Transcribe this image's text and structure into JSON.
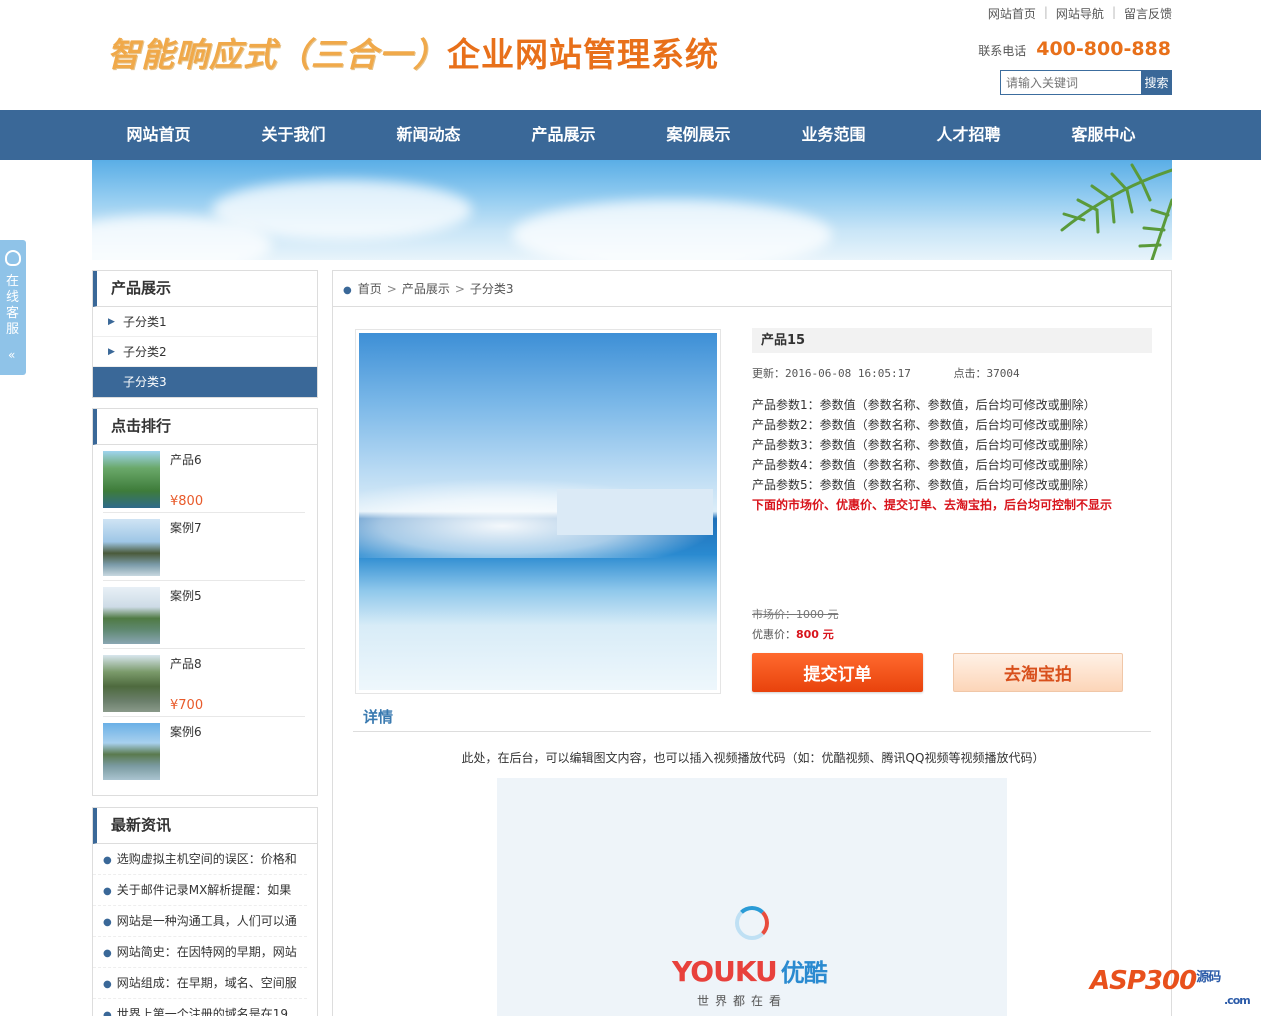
{
  "header": {
    "top_links": [
      "网站首页",
      "网站导航",
      "留言反馈"
    ],
    "title_part1": "智能响应式（三合一）",
    "title_part2": "企业网站管理系统",
    "phone_label": "联系电话",
    "phone_number": "400-800-888",
    "search_placeholder": "请输入关键词",
    "search_button": "搜索"
  },
  "nav": [
    "网站首页",
    "关于我们",
    "新闻动态",
    "产品展示",
    "案例展示",
    "业务范围",
    "人才招聘",
    "客服中心"
  ],
  "service_tab": {
    "label": "在线客服",
    "arrow": "«"
  },
  "sidebar": {
    "categories": {
      "title": "产品展示",
      "items": [
        {
          "label": "子分类1",
          "active": false
        },
        {
          "label": "子分类2",
          "active": false
        },
        {
          "label": "子分类3",
          "active": true
        }
      ]
    },
    "ranking": {
      "title": "点击排行",
      "items": [
        {
          "name": "产品6",
          "price": "¥800"
        },
        {
          "name": "案例7",
          "price": ""
        },
        {
          "name": "案例5",
          "price": ""
        },
        {
          "name": "产品8",
          "price": "¥700"
        },
        {
          "name": "案例6",
          "price": ""
        }
      ]
    },
    "news": {
      "title": "最新资讯",
      "items": [
        "选购虚拟主机空间的误区：价格和",
        "关于邮件记录MX解析提醒：如果",
        "网站是一种沟通工具，人们可以通",
        "网站简史：在因特网的早期，网站",
        "网站组成：在早期，域名、空间服",
        "世界上第一个注册的域名是在19"
      ]
    }
  },
  "breadcrumb": [
    "首页",
    "产品展示",
    "子分类3"
  ],
  "product": {
    "title": "产品15",
    "updated_label": "更新：",
    "updated": "2016-06-08 16:05:17",
    "hits_label": "点击：",
    "hits": "37004",
    "params": [
      "产品参数1：参数值（参数名称、参数值，后台均可修改或删除）",
      "产品参数2：参数值（参数名称、参数值，后台均可修改或删除）",
      "产品参数3：参数值（参数名称、参数值，后台均可修改或删除）",
      "产品参数4：参数值（参数名称、参数值，后台均可修改或删除）",
      "产品参数5：参数值（参数名称、参数值，后台均可修改或删除）"
    ],
    "note": "下面的市场价、优惠价、提交订单、去淘宝拍，后台均可控制不显示",
    "market_price_label": "市场价：",
    "market_price": "1000 元",
    "sale_price_label": "优惠价：",
    "sale_price": "800 元",
    "order_button": "提交订单",
    "taobao_button": "去淘宝拍"
  },
  "detail": {
    "heading": "详情",
    "text": "此处，在后台，可以编辑图文内容，也可以插入视频播放代码（如：优酷视频、腾讯QQ视频等视频播放代码）",
    "video_brand": "YOUKU",
    "video_brand_cn": "优酷",
    "video_slogan": "世界都在看"
  },
  "watermark": {
    "main": "ASP300",
    "cn": "源码",
    "com": ".com"
  },
  "colors": {
    "primary": "#3a6898",
    "accent": "#e8701a",
    "price": "#e85a2a",
    "alert": "#d8141c"
  }
}
